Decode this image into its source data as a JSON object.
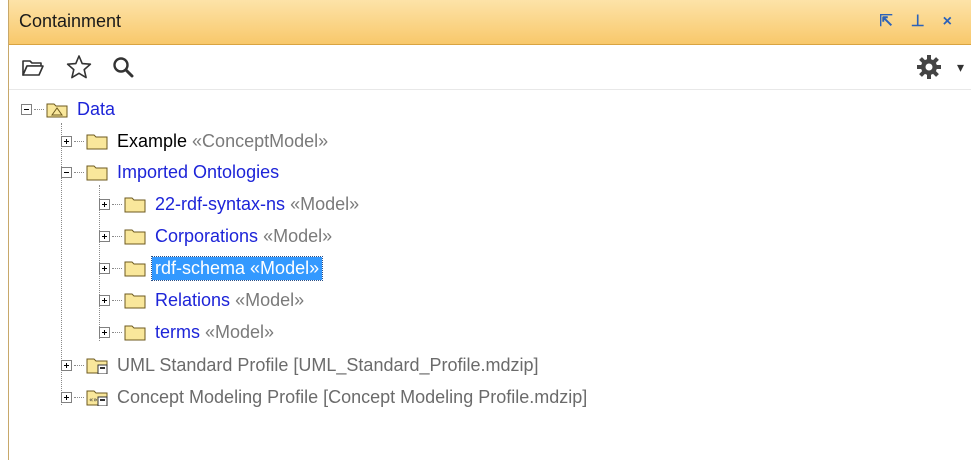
{
  "panel": {
    "title": "Containment",
    "window_controls": [
      {
        "icon": "restore-icon",
        "glyph": "⇱"
      },
      {
        "icon": "pin-icon",
        "glyph": "⊥"
      },
      {
        "icon": "close-icon",
        "glyph": "×"
      }
    ]
  },
  "toolbar": {
    "icons": [
      "open-folder-icon",
      "star-icon",
      "search-icon"
    ],
    "settings_icon": "gear-icon",
    "settings_caret": "▾"
  },
  "tree": {
    "root": {
      "label": "Data"
    },
    "example": {
      "label": "Example",
      "stereotype": "«ConceptModel»"
    },
    "imported": {
      "label": "Imported Ontologies"
    },
    "imported_children": [
      {
        "label": "22-rdf-syntax-ns",
        "stereotype": "«Model»"
      },
      {
        "label": "Corporations",
        "stereotype": "«Model»"
      },
      {
        "label": "rdf-schema",
        "stereotype": "«Model»",
        "selected": true
      },
      {
        "label": "Relations",
        "stereotype": "«Model»"
      },
      {
        "label": "terms",
        "stereotype": "«Model»"
      }
    ],
    "uml_profile": {
      "label": "UML Standard Profile [UML_Standard_Profile.mdzip]"
    },
    "concept_profile": {
      "label": "Concept Modeling Profile [Concept Modeling Profile.mdzip]"
    }
  },
  "colors": {
    "title_bar": "#f8c86b",
    "link_blue": "#1d24d8",
    "selection": "#3399ff",
    "folder": "#f9e79b"
  }
}
